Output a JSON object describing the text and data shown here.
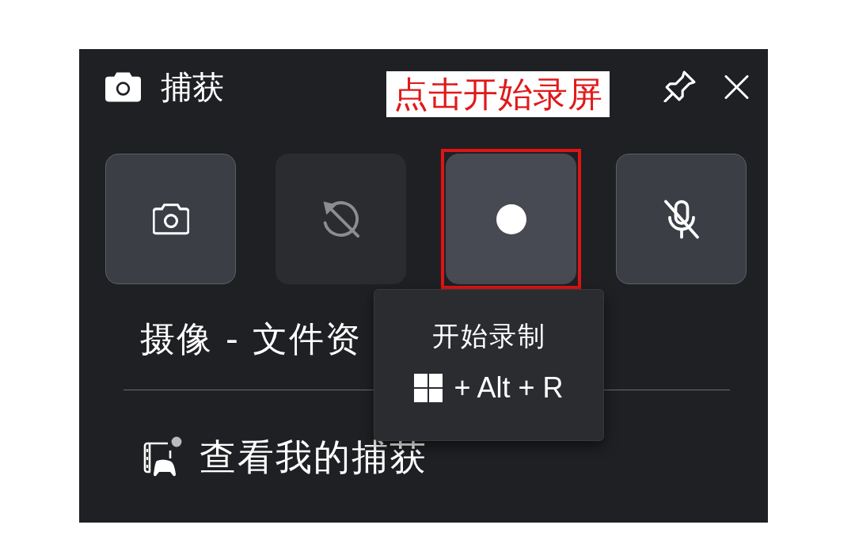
{
  "header": {
    "title": "捕获"
  },
  "annotation": {
    "label": "点击开始录屏"
  },
  "capture_buttons": [
    {
      "kind": "screenshot",
      "disabled": false,
      "hovered": false,
      "highlighted": false
    },
    {
      "kind": "history",
      "disabled": true,
      "hovered": false,
      "highlighted": false
    },
    {
      "kind": "record",
      "disabled": false,
      "hovered": true,
      "highlighted": true
    },
    {
      "kind": "mic-off",
      "disabled": false,
      "hovered": false,
      "highlighted": false
    }
  ],
  "tooltip": {
    "title": "开始录制",
    "shortcut": "+ Alt + R"
  },
  "capture_target": "摄像 - 文件资",
  "gallery_link": {
    "label": "查看我的捕获"
  }
}
